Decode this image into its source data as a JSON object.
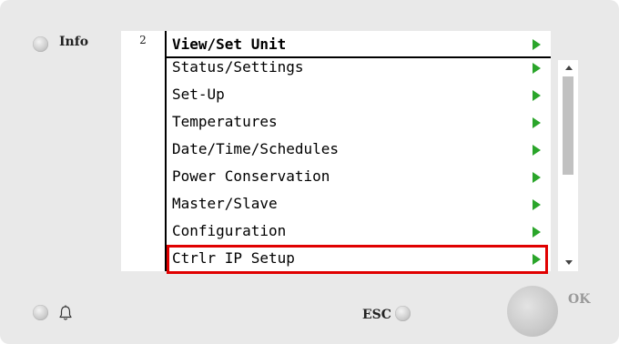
{
  "panel": {
    "info_label": "Info",
    "esc_label": "ESC",
    "ok_label": "OK"
  },
  "screen": {
    "page_number": "2",
    "title": "View/Set Unit",
    "menu_items": [
      {
        "label": "Status/Settings"
      },
      {
        "label": "Set-Up"
      },
      {
        "label": "Temperatures"
      },
      {
        "label": "Date/Time/Schedules"
      },
      {
        "label": "Power Conservation"
      },
      {
        "label": "Master/Slave"
      },
      {
        "label": "Configuration"
      },
      {
        "label": "Ctrlr IP Setup"
      }
    ],
    "highlighted_item": "Ctrlr IP Setup"
  },
  "colors": {
    "arrow": "#2aa52a",
    "highlight_border": "#e00000",
    "panel_background": "#e9e9e9"
  },
  "icons": {
    "alarm": "bell-icon",
    "submenu": "triangle-right-icon"
  }
}
